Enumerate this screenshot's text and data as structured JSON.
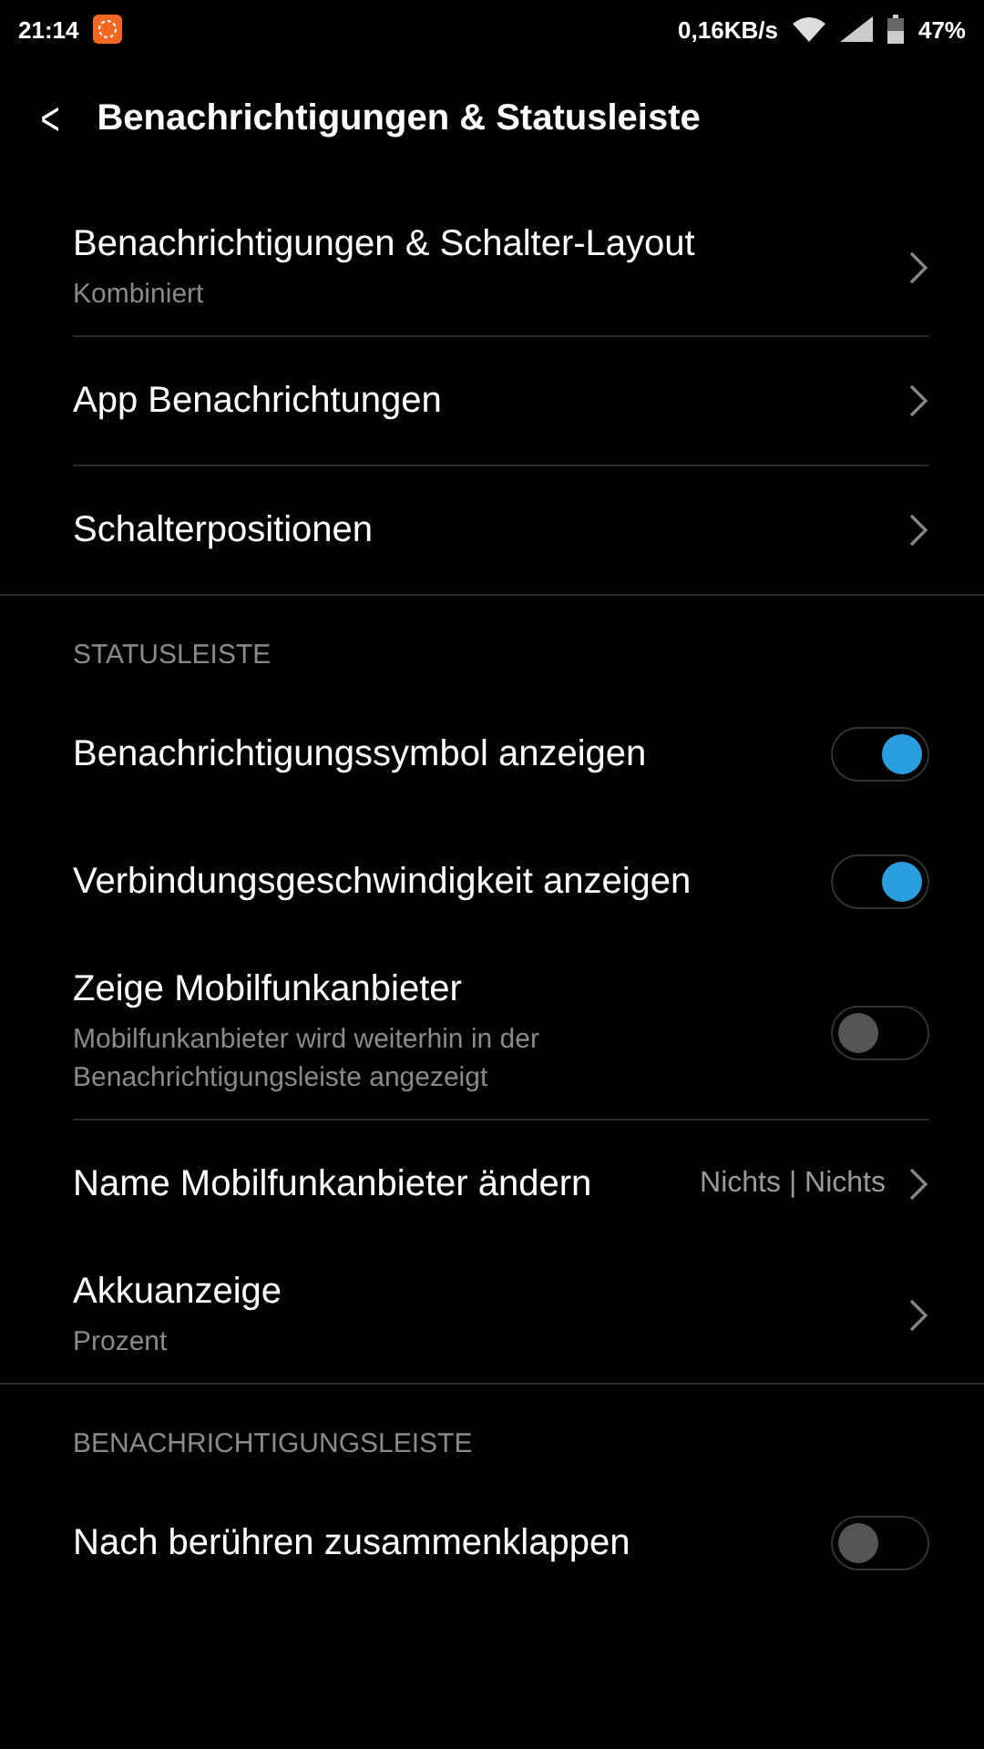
{
  "status_bar": {
    "time": "21:14",
    "speed": "0,16KB/s",
    "battery": "47%"
  },
  "header": {
    "back": "<",
    "title": "Benachrichtigungen & Statusleiste"
  },
  "sections": [
    {
      "blocks": [
        [
          {
            "kind": "link",
            "title": "Benachrichtigungen & Schalter-Layout",
            "subtitle": "Kombiniert"
          }
        ],
        [
          {
            "kind": "link",
            "title": "App Benachrichtungen"
          }
        ],
        [
          {
            "kind": "link",
            "title": "Schalterpositionen"
          }
        ]
      ]
    },
    {
      "heading": "STATUSLEISTE",
      "blocks": [
        [
          {
            "kind": "toggle",
            "title": "Benachrichtigungssymbol anzeigen",
            "on": true
          },
          {
            "kind": "toggle",
            "title": "Verbindungsgeschwindigkeit anzeigen",
            "on": true
          },
          {
            "kind": "toggle",
            "title": "Zeige Mobilfunkanbieter",
            "subtitle": "Mobilfunkanbieter wird weiterhin in der Benachrichtigungsleiste angezeigt",
            "on": false
          }
        ],
        [
          {
            "kind": "link",
            "title": "Name Mobilfunkanbieter ändern",
            "value": "Nichts | Nichts"
          },
          {
            "kind": "link",
            "title": "Akkuanzeige",
            "subtitle": "Prozent"
          }
        ]
      ]
    },
    {
      "heading": "BENACHRICHTIGUNGSLEISTE",
      "blocks": [
        [
          {
            "kind": "toggle",
            "title": "Nach berühren zusammenklappen",
            "on": false
          }
        ]
      ]
    }
  ]
}
